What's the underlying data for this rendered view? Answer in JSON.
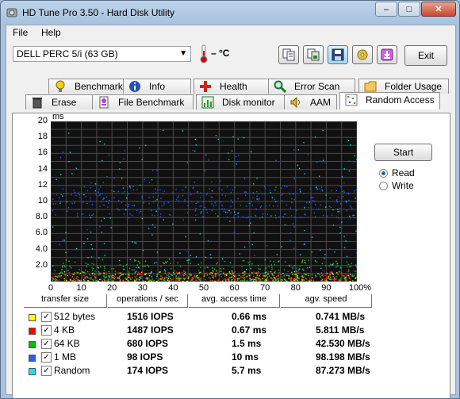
{
  "window": {
    "title": "HD Tune Pro 3.50 - Hard Disk Utility",
    "minimize": "–",
    "maximize": "□",
    "close": "✕"
  },
  "menu": {
    "file": "File",
    "help": "Help"
  },
  "toolbar": {
    "drive": "DELL    PERC 5/i (63 GB)",
    "temperature": "– °C",
    "buttons": [
      "copy-info-icon",
      "copy-screenshot-icon",
      "save-icon",
      "options-icon",
      "download-icon"
    ],
    "exit": "Exit"
  },
  "tabs_top": [
    {
      "label": "Benchmark",
      "icon": "lightbulb-icon"
    },
    {
      "label": "Info",
      "icon": "info-icon"
    },
    {
      "label": "Health",
      "icon": "health-icon"
    },
    {
      "label": "Error Scan",
      "icon": "magnifier-icon"
    },
    {
      "label": "Folder Usage",
      "icon": "folder-icon"
    }
  ],
  "tabs_bottom": [
    {
      "label": "Erase",
      "icon": "trash-icon"
    },
    {
      "label": "File Benchmark",
      "icon": "file-benchmark-icon"
    },
    {
      "label": "Disk monitor",
      "icon": "disk-monitor-icon"
    },
    {
      "label": "AAM",
      "icon": "speaker-icon"
    },
    {
      "label": "Random Access",
      "icon": "random-access-icon",
      "active": true
    }
  ],
  "chart_data": {
    "type": "scatter",
    "ylabel": "ms",
    "yticks": [
      "20",
      "18",
      "16",
      "14",
      "12",
      "10",
      "8.0",
      "6.0",
      "4.0",
      "2.0"
    ],
    "xticks": [
      "0",
      "10",
      "20",
      "30",
      "40",
      "50",
      "60",
      "70",
      "80",
      "90",
      "100%"
    ],
    "xlim": [
      0,
      100
    ],
    "ylim": [
      0,
      20
    ],
    "grid": true,
    "series": [
      {
        "color": "#e8e800",
        "band": [
          0.1,
          1.3
        ]
      },
      {
        "color": "#e82020",
        "band": [
          0.1,
          1.4
        ]
      },
      {
        "color": "#20c020",
        "band": [
          0.2,
          2.8
        ]
      },
      {
        "color": "#2a5cff",
        "band": [
          8.0,
          12.0
        ]
      },
      {
        "color": "#20d0e0",
        "band": [
          0.5,
          19.0
        ]
      }
    ]
  },
  "controls": {
    "start": "Start",
    "read": "Read",
    "write": "Write",
    "mode": "read"
  },
  "results": {
    "headers": [
      "transfer size",
      "operations / sec",
      "avg. access time",
      "agv. speed"
    ],
    "rows": [
      {
        "color": "#ffff00",
        "size": "512 bytes",
        "ops": "1516 IOPS",
        "access": "0.66 ms",
        "speed": "0.741 MB/s"
      },
      {
        "color": "#ff0000",
        "size": "4 KB",
        "ops": "1487 IOPS",
        "access": "0.67 ms",
        "speed": "5.811 MB/s"
      },
      {
        "color": "#00c000",
        "size": "64 KB",
        "ops": "680 IOPS",
        "access": "1.5 ms",
        "speed": "42.530 MB/s"
      },
      {
        "color": "#1f5fff",
        "size": "1 MB",
        "ops": "98 IOPS",
        "access": "10 ms",
        "speed": "98.198 MB/s"
      },
      {
        "color": "#20e0f0",
        "size": "Random",
        "ops": "174 IOPS",
        "access": "5.7 ms",
        "speed": "87.273 MB/s"
      }
    ]
  }
}
